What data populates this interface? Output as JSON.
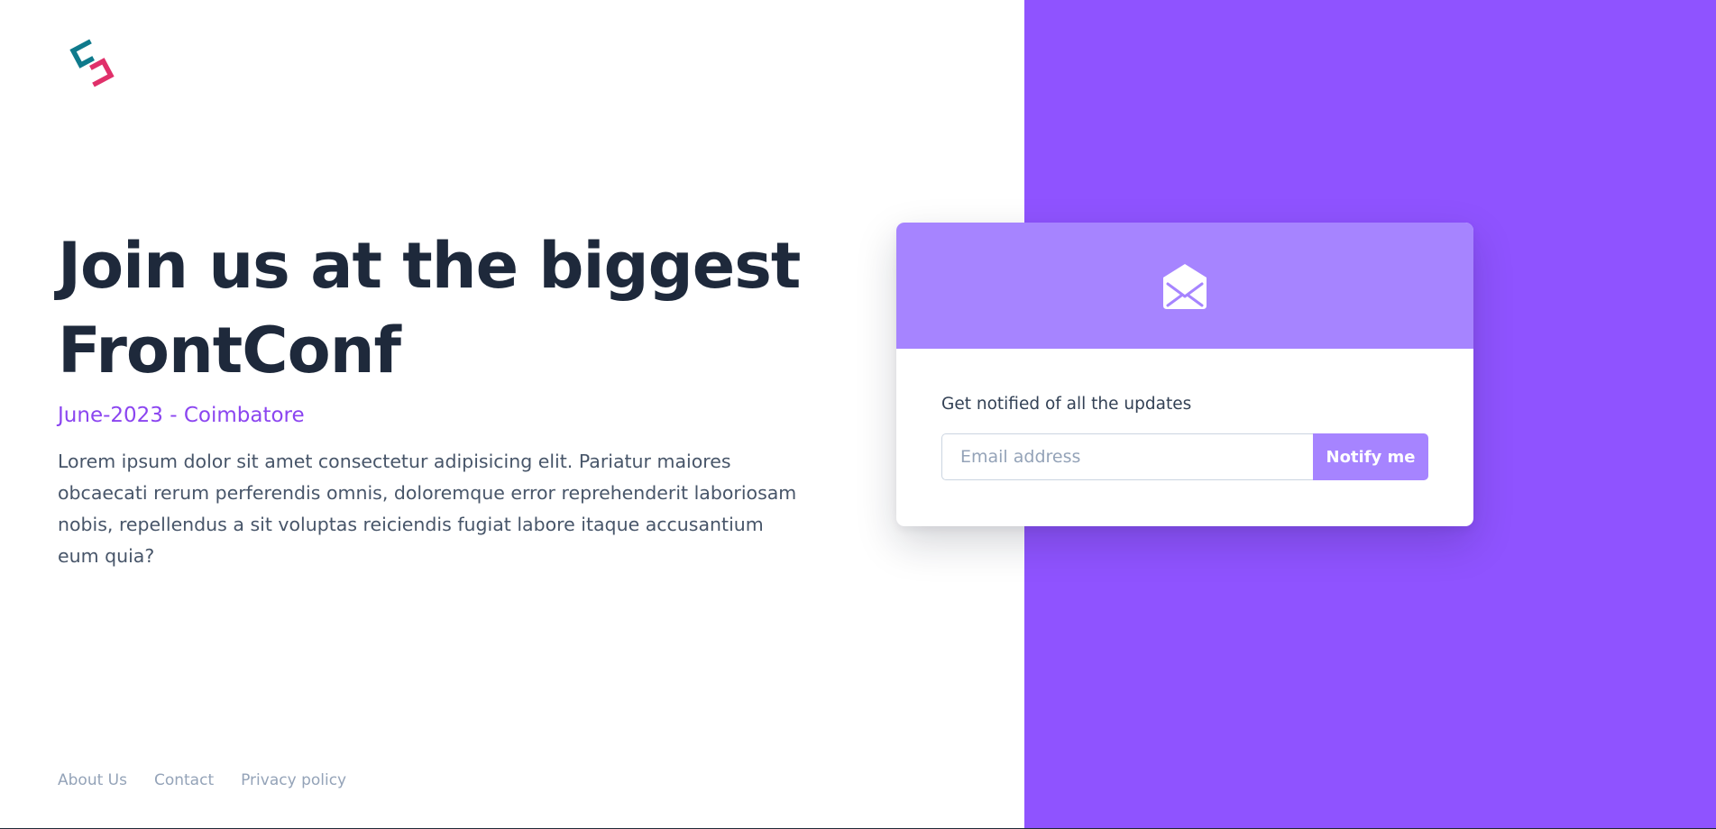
{
  "colors": {
    "accent": "#8f53ff",
    "card_header": "#a684ff",
    "heading": "#1e293b",
    "subtitle": "#8b45f0",
    "logo_teal": "#0f7a8c",
    "logo_pink": "#e0306a"
  },
  "brand": {
    "logo_icon": "s-logo-icon"
  },
  "hero": {
    "title": "Join us at the biggest FrontConf",
    "subtitle": "June-2023 - Coimbatore",
    "description": "Lorem ipsum dolor sit amet consectetur adipisicing elit. Pariatur maiores obcaecati rerum perferendis omnis, doloremque error reprehenderit laboriosam nobis, repellendus a sit voluptas reiciendis fugiat labore itaque accusantium eum quia?"
  },
  "signup": {
    "header_icon": "envelope-open-icon",
    "label": "Get notified of all the updates",
    "email_placeholder": "Email address",
    "button_label": "Notify me"
  },
  "footer": {
    "links": [
      {
        "label": "About Us"
      },
      {
        "label": "Contact"
      },
      {
        "label": "Privacy policy"
      }
    ]
  }
}
